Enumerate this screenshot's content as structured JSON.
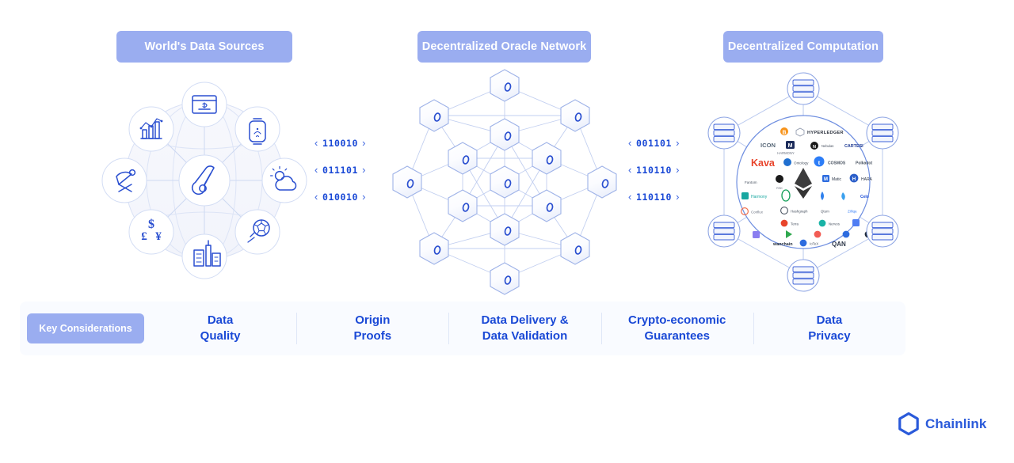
{
  "columns": [
    {
      "id": "sources",
      "label": "World's Data Sources"
    },
    {
      "id": "oracle",
      "label": "Decentralized Oracle Network"
    },
    {
      "id": "compute",
      "label": "Decentralized Computation"
    }
  ],
  "streams": {
    "left": {
      "rows": [
        "110010",
        "011101",
        "010010"
      ]
    },
    "right": {
      "rows": [
        "001101",
        "110110",
        "110110"
      ]
    },
    "open_chevron": "‹",
    "close_chevron": "›"
  },
  "data_sources": {
    "icons": [
      "payment-terminal-icon",
      "bar-chart-trend-icon",
      "smartwatch-icon",
      "weather-sun-cloud-icon",
      "thermometer-icon",
      "currency-exchange-icon",
      "soccer-ball-icon",
      "city-buildings-icon",
      "satellite-dish-icon"
    ]
  },
  "oracle_network": {
    "node_count": 15,
    "node_glyph": "oracle-hex-node-icon"
  },
  "computation": {
    "server_node_count": 6,
    "server_glyph": "server-stack-icon",
    "blockchain_logos": [
      "Bitcoin",
      "HYPERLEDGER",
      "ICON",
      "Harmony",
      "Nebulas",
      "Cartesi",
      "Kava",
      "Ontology",
      "Tezos",
      "COSMOS",
      "Polkadot",
      "Ethereum",
      "Matic",
      "Hara",
      "Fantom",
      "Celo",
      "Conflux",
      "Qtum",
      "Zilliqa",
      "Terra",
      "Avalanche",
      "Nervos",
      "Band",
      "Loopring",
      "IoTeX",
      "Plasm",
      "Wanchain",
      "QAN"
    ],
    "center_logo": "Ethereum"
  },
  "considerations": {
    "pill_label": "Key Considerations",
    "items": [
      {
        "line1": "Data",
        "line2": "Quality"
      },
      {
        "line1": "Origin",
        "line2": "Proofs"
      },
      {
        "line1": "Data Delivery &",
        "line2": "Data Validation"
      },
      {
        "line1": "Crypto-economic",
        "line2": "Guarantees"
      },
      {
        "line1": "Data",
        "line2": "Privacy"
      }
    ]
  },
  "footer": {
    "brand": "Chainlink",
    "logo_icon": "chainlink-hexagon-icon"
  },
  "colors": {
    "pill_bg": "#9aadf0",
    "accent_blue": "#1a49d6",
    "line_blue": "#aebdec",
    "bar_bg": "#f9fbff",
    "page_bg": "#ffffff"
  }
}
